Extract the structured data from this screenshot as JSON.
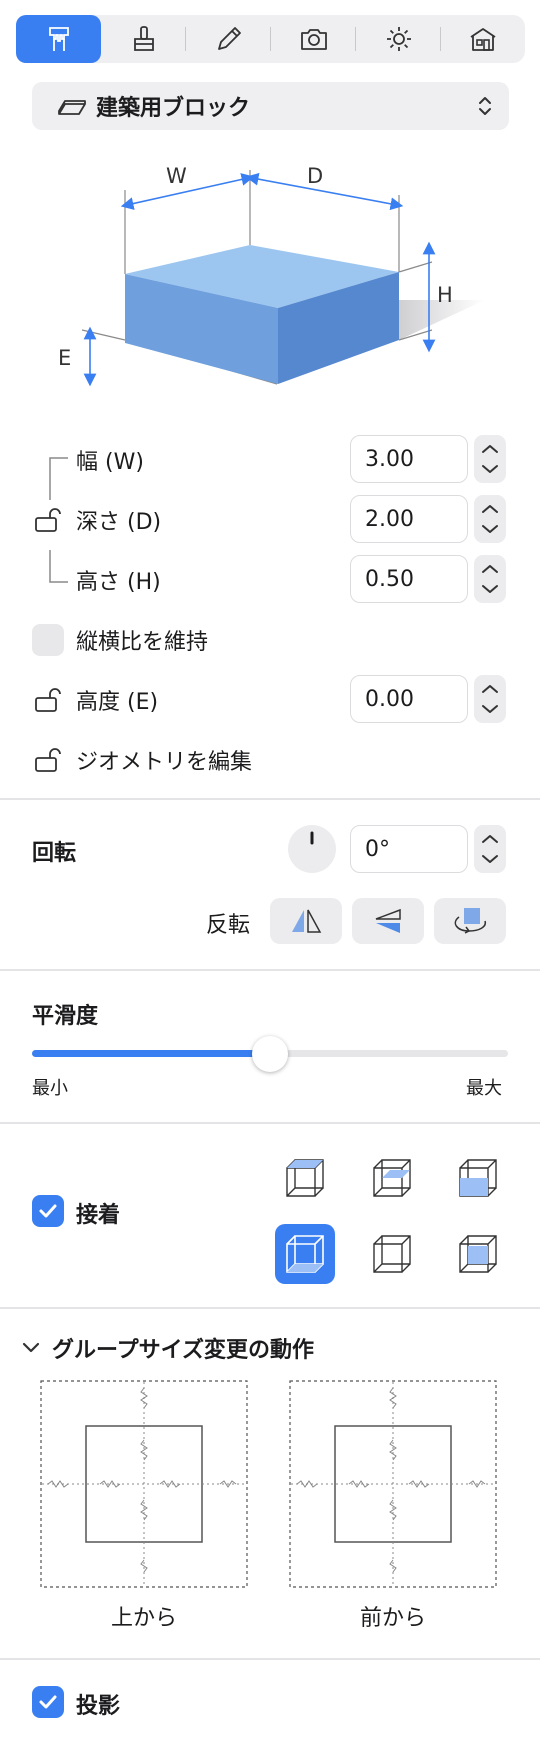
{
  "toolbar": {
    "tools": [
      "ruler-tool-icon",
      "brush-tool-icon",
      "pencil-tool-icon",
      "camera-tool-icon",
      "sun-tool-icon",
      "house-tool-icon"
    ],
    "active_index": 0
  },
  "object_selector": {
    "label": "建築用ブロック"
  },
  "diagram": {
    "w": "W",
    "d": "D",
    "h": "H",
    "e": "E"
  },
  "dimensions": [
    {
      "label": "幅 (W)",
      "value": "3.00"
    },
    {
      "label": "深さ (D)",
      "value": "2.00"
    },
    {
      "label": "高さ (H)",
      "value": "0.50"
    }
  ],
  "keep_aspect": {
    "label": "縦横比を維持",
    "checked": false
  },
  "elevation": {
    "label": "高度 (E)",
    "value": "0.00"
  },
  "edit_geometry": {
    "label": "ジオメトリを編集"
  },
  "rotation": {
    "title": "回転",
    "value": "0°",
    "flip_label": "反転"
  },
  "smoothness": {
    "title": "平滑度",
    "min_label": "最小",
    "max_label": "最大",
    "value": 0.5
  },
  "snap": {
    "label": "接着",
    "checked": true,
    "active_index": 3
  },
  "group_resize": {
    "title": "グループサイズ変更の動作",
    "views": [
      {
        "caption": "上から"
      },
      {
        "caption": "前から"
      }
    ]
  },
  "projection": {
    "label": "投影",
    "checked": true
  },
  "colors": {
    "accent": "#3a7ff2",
    "block_top": "#9cc6f0",
    "block_left": "#6fa0dd",
    "block_right": "#5588cf"
  }
}
